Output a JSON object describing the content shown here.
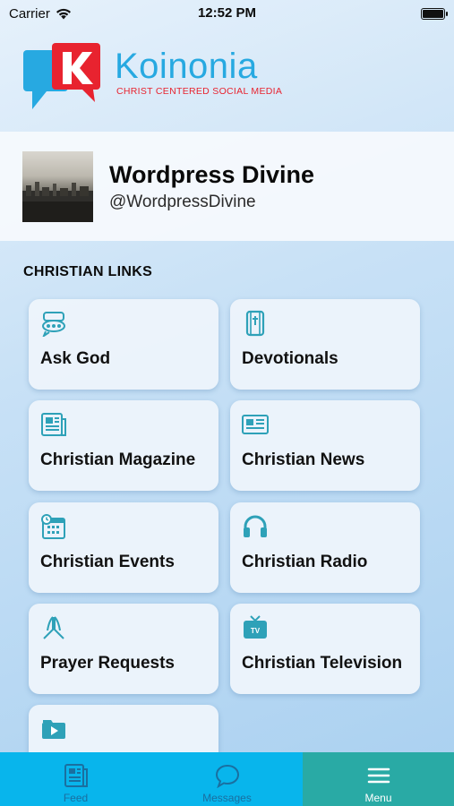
{
  "status_bar": {
    "carrier": "Carrier",
    "time": "12:52 PM"
  },
  "logo": {
    "name": "Koinonia",
    "tagline": "CHRIST CENTERED SOCIAL MEDIA"
  },
  "profile": {
    "name": "Wordpress Divine",
    "handle": "@WordpressDivine"
  },
  "section": {
    "title": "CHRISTIAN LINKS"
  },
  "links": [
    {
      "label": "Ask God",
      "icon": "ask-god-icon"
    },
    {
      "label": "Devotionals",
      "icon": "bible-icon"
    },
    {
      "label": "Christian Magazine",
      "icon": "magazine-icon"
    },
    {
      "label": "Christian News",
      "icon": "newspaper-icon"
    },
    {
      "label": "Christian Events",
      "icon": "calendar-icon"
    },
    {
      "label": "Christian Radio",
      "icon": "headphones-icon"
    },
    {
      "label": "Prayer Requests",
      "icon": "praying-hands-icon"
    },
    {
      "label": "Christian Television",
      "icon": "tv-icon"
    },
    {
      "label": "",
      "icon": "video-icon"
    }
  ],
  "tabs": [
    {
      "label": "Feed",
      "icon": "feed-icon"
    },
    {
      "label": "Messages",
      "icon": "chat-bubble-icon"
    },
    {
      "label": "Menu",
      "icon": "hamburger-menu-icon"
    }
  ],
  "colors": {
    "logo_blue": "#27a9e1",
    "logo_red": "#e8232f",
    "icon_teal": "#2ea1b8",
    "tab_blue": "#08b5ec",
    "tab_active": "#29aaa5"
  }
}
